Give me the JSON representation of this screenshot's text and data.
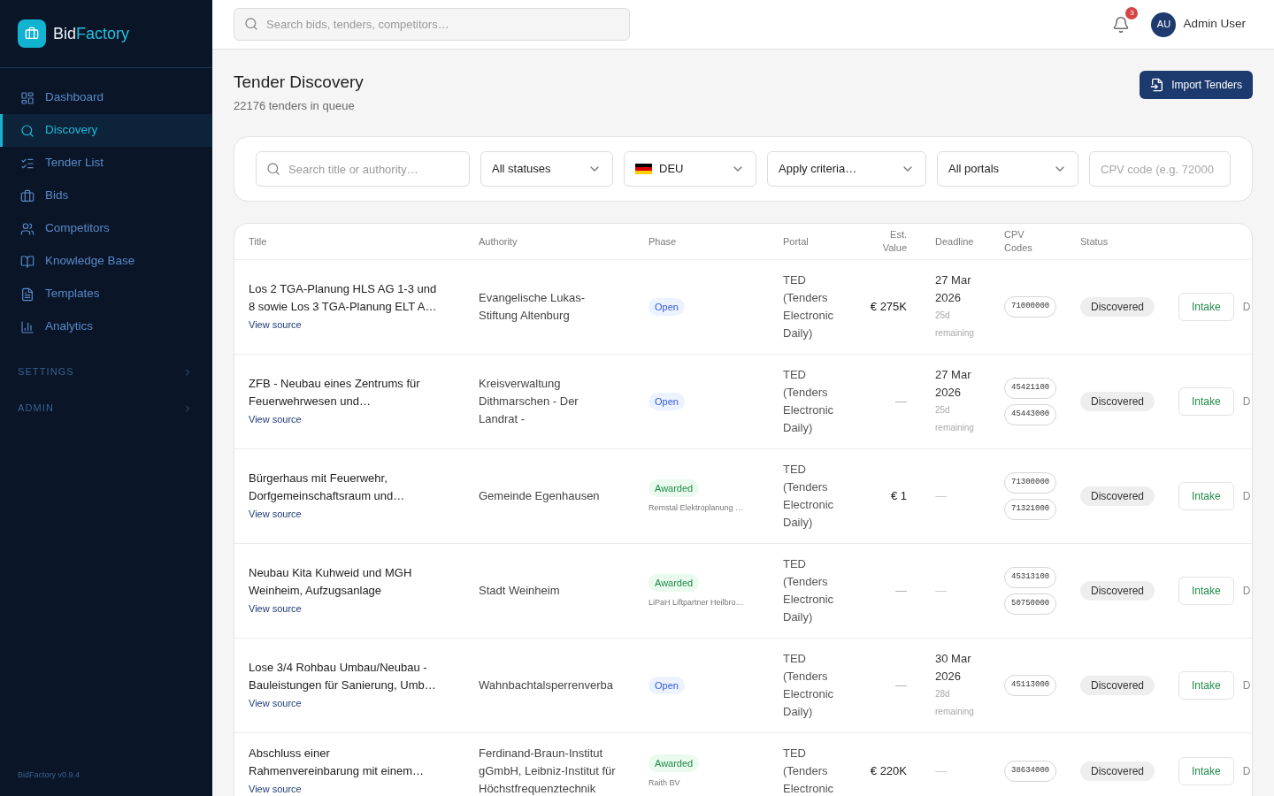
{
  "sidebar": {
    "logo": {
      "prefix": "Bid",
      "suffix": "Factory"
    },
    "nav": [
      {
        "label": "Dashboard",
        "selected": false
      },
      {
        "label": "Discovery",
        "selected": true
      },
      {
        "label": "Tender List",
        "selected": false
      },
      {
        "label": "Bids",
        "selected": false
      },
      {
        "label": "Competitors",
        "selected": false
      },
      {
        "label": "Knowledge Base",
        "selected": false
      },
      {
        "label": "Templates",
        "selected": false
      },
      {
        "label": "Analytics",
        "selected": false
      }
    ],
    "sections": [
      {
        "label": "SETTINGS"
      },
      {
        "label": "ADMIN"
      }
    ],
    "version": "BidFactory v0.9.4"
  },
  "topbar": {
    "search": {
      "placeholder": "Search bids, tenders, competitors…"
    },
    "notifications": {
      "count": "3"
    },
    "user": {
      "initials": "AU",
      "name": "Admin User"
    }
  },
  "page": {
    "title": "Tender Discovery",
    "subtitle": "22176 tenders in queue",
    "import_button": "Import Tenders"
  },
  "filters": [
    {
      "kind": "search",
      "placeholder": "Search title or authority…"
    },
    {
      "kind": "select",
      "value": "All statuses"
    },
    {
      "kind": "country",
      "value": "DEU"
    },
    {
      "kind": "select",
      "value": "Apply criteria…"
    },
    {
      "kind": "select",
      "value": "All portals"
    },
    {
      "kind": "input",
      "placeholder": "CPV code (e.g. 72000"
    }
  ],
  "table": {
    "columns": [
      "Title",
      "Authority",
      "Phase",
      "Portal",
      "Est. Value",
      "Deadline",
      "CPV Codes",
      "Status"
    ],
    "rows": [
      {
        "title": "Los 2 TGA-Planung HLS AG 1-3 und 8 sowie Los 3 TGA-Planung ELT A…",
        "link": "View source",
        "authority": "Evangelische Lukas-Stiftung Altenburg",
        "phase": {
          "label": "Open",
          "kind": "open"
        },
        "portal": "TED (Tenders Electronic Daily)",
        "value": {
          "kind": "amount",
          "text": "€ 275K"
        },
        "deadline": {
          "kind": "date",
          "date": "27 Mar 2026",
          "remaining": "25d remaining"
        },
        "cpv": [
          "71000000"
        ],
        "status": "Discovered",
        "actions": [
          {
            "label": "Intake",
            "kind": "outline"
          },
          {
            "label": "D",
            "kind": "ghost"
          }
        ]
      },
      {
        "title": "ZFB - Neubau eines Zentrums für Feuerwehrwesen und…",
        "link": "View source",
        "authority": "Kreisverwaltung Dithmarschen - Der Landrat -",
        "phase": {
          "label": "Open",
          "kind": "open"
        },
        "portal": "TED (Tenders Electronic Daily)",
        "value": {
          "kind": "none",
          "text": "—"
        },
        "deadline": {
          "kind": "date",
          "date": "27 Mar 2026",
          "remaining": "25d remaining"
        },
        "cpv": [
          "45421100",
          "45443000"
        ],
        "status": "Discovered",
        "actions": [
          {
            "label": "Intake",
            "kind": "outline"
          },
          {
            "label": "D",
            "kind": "ghost"
          }
        ]
      },
      {
        "title": "Bürgerhaus mit Feuerwehr, Dorfgemeinschaftsraum und…",
        "link": "View source",
        "authority": "Gemeinde Egenhausen",
        "phase": {
          "label": "Awarded",
          "kind": "awarded",
          "winner": "Remstal Elektroplanung …"
        },
        "portal": "TED (Tenders Electronic Daily)",
        "value": {
          "kind": "amount",
          "text": "€ 1"
        },
        "deadline": {
          "kind": "none",
          "date": "—"
        },
        "cpv": [
          "71300000",
          "71321000"
        ],
        "status": "Discovered",
        "actions": [
          {
            "label": "Intake",
            "kind": "outline"
          },
          {
            "label": "D",
            "kind": "ghost"
          }
        ]
      },
      {
        "title": "Neubau Kita Kuhweid und MGH Weinheim, Aufzugsanlage",
        "link": "View source",
        "authority": "Stadt Weinheim",
        "phase": {
          "label": "Awarded",
          "kind": "awarded",
          "winner": "LiPaH Liftpartner Heilbro…"
        },
        "portal": "TED (Tenders Electronic Daily)",
        "value": {
          "kind": "none",
          "text": "—"
        },
        "deadline": {
          "kind": "none",
          "date": "—"
        },
        "cpv": [
          "45313100",
          "50750000"
        ],
        "status": "Discovered",
        "actions": [
          {
            "label": "Intake",
            "kind": "outline"
          },
          {
            "label": "D",
            "kind": "ghost"
          }
        ]
      },
      {
        "title": "Lose 3/4 Rohbau Umbau/Neubau - Bauleistungen für Sanierung, Umb…",
        "link": "View source",
        "authority": "Wahnbachtalsperrenverba",
        "phase": {
          "label": "Open",
          "kind": "open"
        },
        "portal": "TED (Tenders Electronic Daily)",
        "value": {
          "kind": "none",
          "text": "—"
        },
        "deadline": {
          "kind": "date",
          "date": "30 Mar 2026",
          "remaining": "28d remaining"
        },
        "cpv": [
          "45113000"
        ],
        "status": "Discovered",
        "actions": [
          {
            "label": "Intake",
            "kind": "outline"
          },
          {
            "label": "D",
            "kind": "ghost"
          }
        ]
      },
      {
        "title": "Abschluss einer Rahmenvereinbarung mit einem…",
        "link": "View source",
        "authority": "Ferdinand-Braun-Institut gGmbH, Leibniz-Institut für Höchstfrequenztechnik",
        "phase": {
          "label": "Awarded",
          "kind": "awarded",
          "winner": "Raith BV"
        },
        "portal": "TED (Tenders Electronic",
        "value": {
          "kind": "amount",
          "text": "€ 220K"
        },
        "deadline": {
          "kind": "none",
          "date": "—"
        },
        "cpv": [
          "38634000"
        ],
        "status": "Discovered",
        "actions": [
          {
            "label": "Intake",
            "kind": "outline"
          },
          {
            "label": "D",
            "kind": "ghost"
          }
        ]
      }
    ]
  }
}
